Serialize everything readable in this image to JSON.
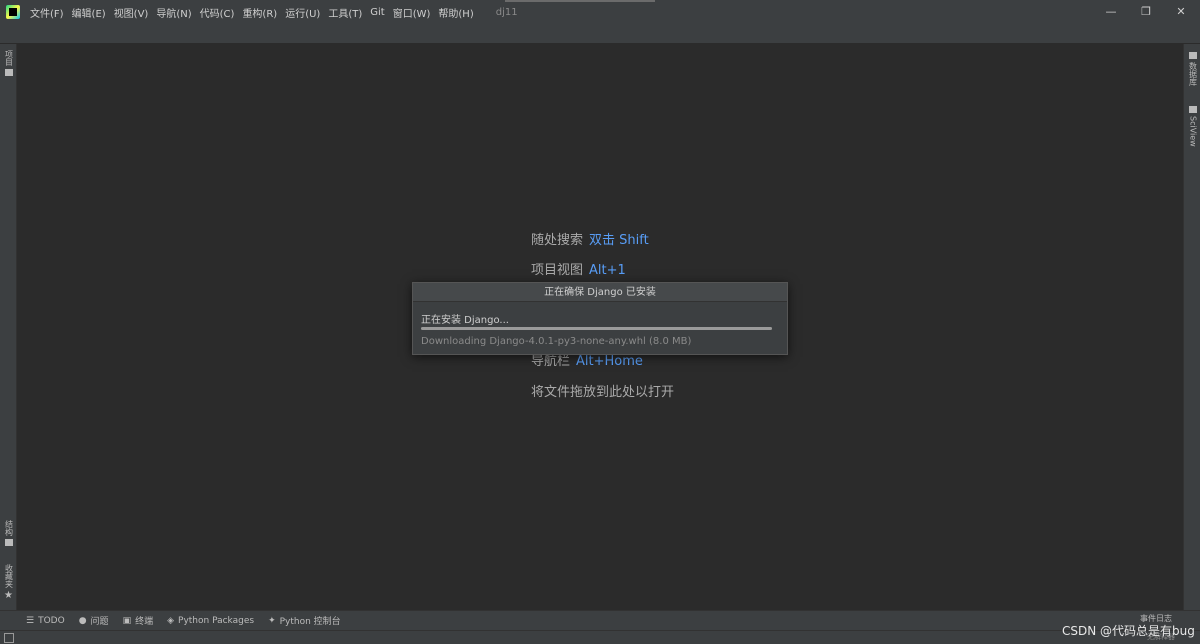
{
  "window": {
    "project_title": "dj11",
    "controls": {
      "minimize": "—",
      "maximize": "❐",
      "close": "✕"
    }
  },
  "menu": [
    "文件(F)",
    "编辑(E)",
    "视图(V)",
    "导航(N)",
    "代码(C)",
    "重构(R)",
    "运行(U)",
    "工具(T)",
    "Git",
    "窗口(W)",
    "帮助(H)"
  ],
  "left_tools": {
    "project": "项目",
    "structure": "结构",
    "favorites": "收藏夹"
  },
  "right_tools": {
    "database": "数据库",
    "sciview": "SciView"
  },
  "hints": [
    {
      "label": "随处搜索",
      "key": "双击 Shift"
    },
    {
      "label": "项目视图",
      "key": "Alt+1"
    },
    {
      "label": "导航栏",
      "key": "Alt+Home"
    },
    {
      "label": "将文件拖放到此处以打开",
      "key": ""
    }
  ],
  "dialog": {
    "title": "正在确保 Django 已安装",
    "status": "正在安装 Django...",
    "detail": "Downloading Django-4.0.1-py3-none-any.whl (8.0 MB)",
    "progress": 1.0
  },
  "bottom_tabs": [
    {
      "icon": "list-icon",
      "glyph": "☰",
      "label": "TODO"
    },
    {
      "icon": "info-icon",
      "glyph": "●",
      "label": "问题"
    },
    {
      "icon": "terminal-icon",
      "glyph": "▣",
      "label": "终端"
    },
    {
      "icon": "packages-icon",
      "glyph": "◈",
      "label": "Python Packages"
    },
    {
      "icon": "python-icon",
      "glyph": "✦",
      "label": "Python 控制台"
    }
  ],
  "event_log": "事件日志",
  "status_right": "无解释器",
  "watermark": "CSDN @代码总是有bug"
}
